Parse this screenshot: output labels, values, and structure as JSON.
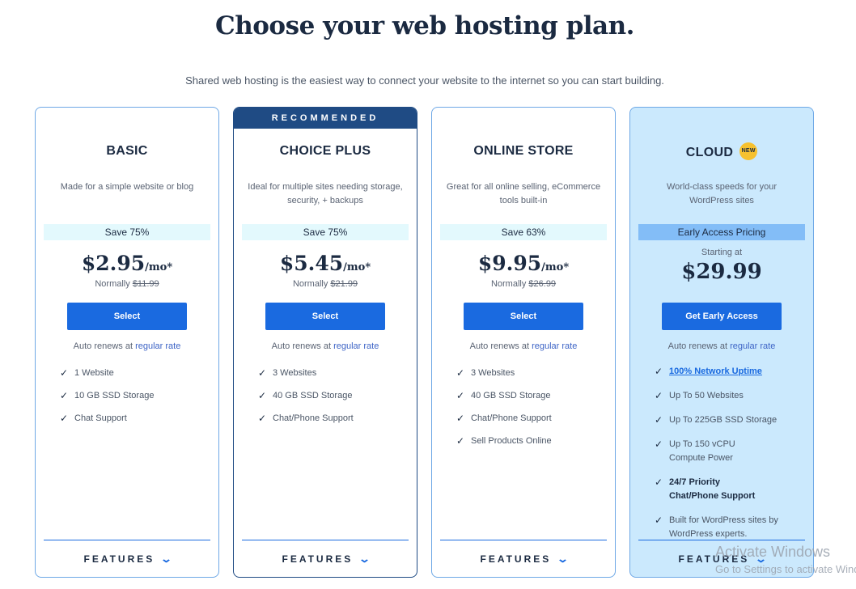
{
  "header": {
    "title": "Choose your web hosting plan.",
    "subtitle": "Shared web hosting is the easiest way to connect your website to the internet so you can start building."
  },
  "plans": [
    {
      "name": "BASIC",
      "description": "Made for a simple website or blog",
      "save": "Save 75%",
      "price": "$2.95",
      "price_unit": "/mo*",
      "normally_label": "Normally",
      "normally_price": "$11.99",
      "button": "Select",
      "renew_prefix": "Auto renews at",
      "renew_link": "regular rate",
      "features": [
        "1 Website",
        "10 GB SSD Storage",
        "Chat Support"
      ],
      "features_toggle": "FEATURES"
    },
    {
      "name": "CHOICE PLUS",
      "ribbon": "RECOMMENDED",
      "description": "Ideal for multiple sites needing storage, security, + backups",
      "save": "Save 75%",
      "price": "$5.45",
      "price_unit": "/mo*",
      "normally_label": "Normally",
      "normally_price": "$21.99",
      "button": "Select",
      "renew_prefix": "Auto renews at",
      "renew_link": "regular rate",
      "features": [
        "3 Websites",
        "40 GB SSD Storage",
        "Chat/Phone Support"
      ],
      "features_toggle": "FEATURES"
    },
    {
      "name": "ONLINE STORE",
      "description": "Great for all online selling, eCommerce tools built-in",
      "save": "Save 63%",
      "price": "$9.95",
      "price_unit": "/mo*",
      "normally_label": "Normally",
      "normally_price": "$26.99",
      "button": "Select",
      "renew_prefix": "Auto renews at",
      "renew_link": "regular rate",
      "features": [
        "3 Websites",
        "40 GB SSD Storage",
        "Chat/Phone Support",
        "Sell Products Online"
      ],
      "features_toggle": "FEATURES"
    },
    {
      "name": "CLOUD",
      "badge": "NEW",
      "description": "World-class speeds for your WordPress sites",
      "save": "Early Access Pricing",
      "starting_label": "Starting at",
      "price": "$29.99",
      "button": "Get Early Access",
      "renew_prefix": "Auto renews at",
      "renew_link": "regular rate",
      "features": [
        "100% Network Uptime",
        "Up To 50 Websites",
        "Up To 225GB SSD Storage",
        "Up To 150 vCPU Compute Power",
        "24/7 Priority Chat/Phone Support",
        "Built for WordPress sites by WordPress experts."
      ],
      "features_toggle": "FEATURES"
    }
  ],
  "watermark": {
    "line1": "Activate Windows",
    "line2": "Go to Settings to activate Windows."
  },
  "colors": {
    "primary_button": "#1a6ae0",
    "recommended_bar": "#1f4b84",
    "cloud_background": "#cbe9fd",
    "save_band": "#e3f9fd",
    "early_access_band": "#83bdf7",
    "new_badge": "#f6c12f"
  }
}
